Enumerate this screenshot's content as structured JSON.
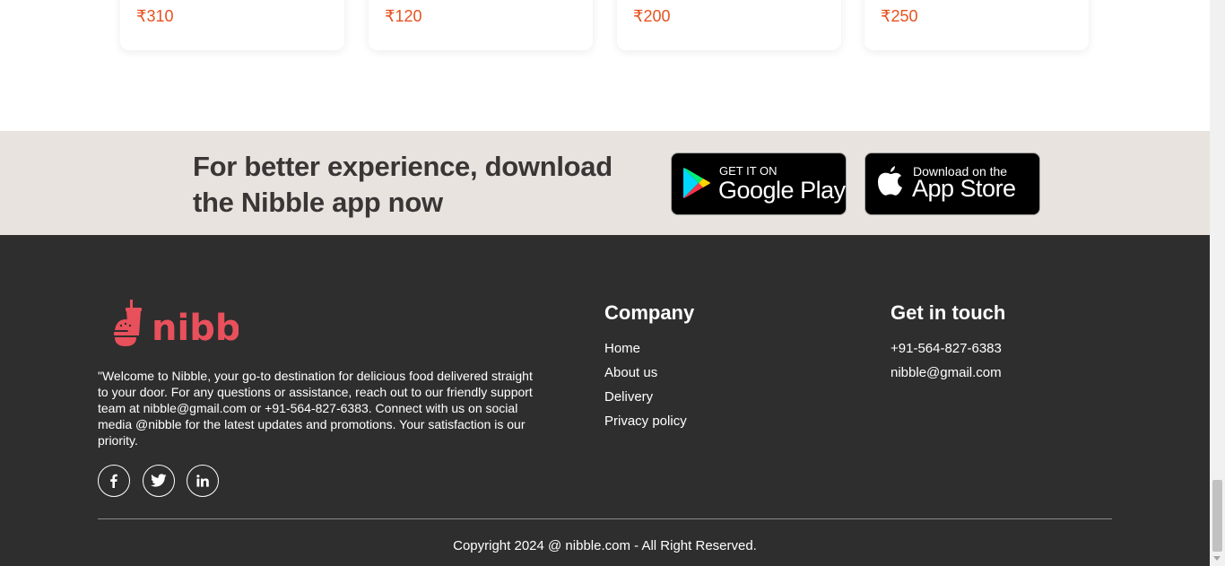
{
  "cards": [
    {
      "price": "₹310"
    },
    {
      "price": "₹120"
    },
    {
      "price": "₹200"
    },
    {
      "price": "₹250"
    }
  ],
  "banner": {
    "headline": "For better experience, download the Nibble app now",
    "google_play": {
      "small": "GET IT ON",
      "big": "Google Play"
    },
    "app_store": {
      "small": "Download on the",
      "big": "App Store"
    }
  },
  "footer": {
    "brand": "nibble",
    "about": "\"Welcome to Nibble, your go-to destination for delicious food delivered straight to your door. For any questions or assistance, reach out to our friendly support team at nibble@gmail.com or +91-564-827-6383. Connect with us on social media @nibble for the latest updates and promotions. Your satisfaction is our priority.",
    "socials": [
      "facebook-icon",
      "twitter-icon",
      "linkedin-icon"
    ],
    "company": {
      "title": "Company",
      "links": [
        "Home",
        "About us",
        "Delivery",
        "Privacy policy"
      ]
    },
    "contact": {
      "title": "Get in touch",
      "phone": "+91-564-827-6383",
      "email": "nibble@gmail.com"
    },
    "copyright": "Copyright 2024 @ nibble.com - All Right Reserved."
  },
  "colors": {
    "price": "#e8511f",
    "brand": "#e8505b",
    "footer_bg": "#2f2e2e",
    "banner_bg": "#e8e3de"
  }
}
